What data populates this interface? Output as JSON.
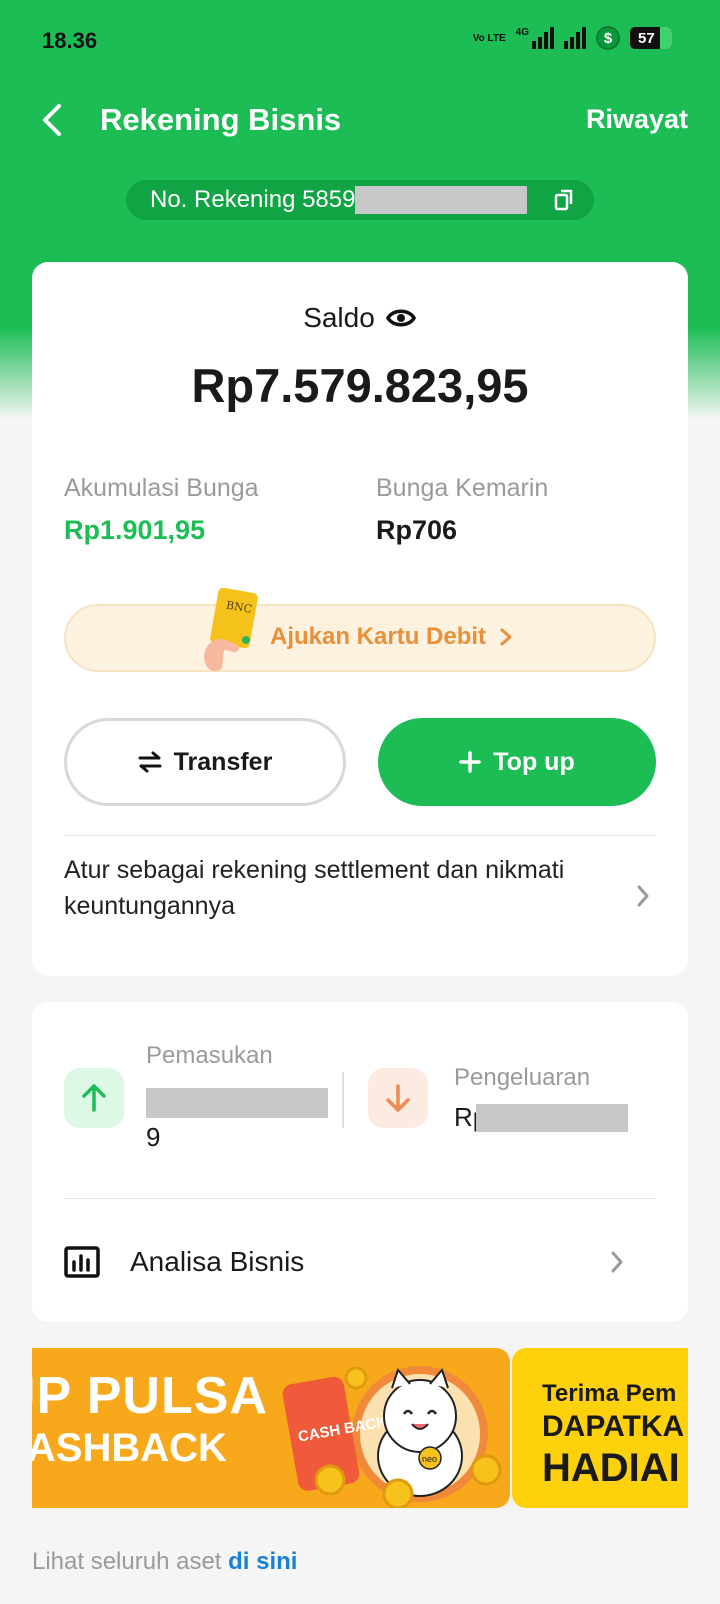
{
  "status_bar": {
    "time": "18.36",
    "network_type": "4G",
    "lte_label": "Vo LTE",
    "battery": "57"
  },
  "header": {
    "title": "Rekening Bisnis",
    "history_label": "Riwayat",
    "account_prefix": "No. Rekening 5859"
  },
  "balance_card": {
    "saldo_label": "Saldo",
    "balance": "Rp7.579.823,95",
    "accumulated_interest_label": "Akumulasi Bunga",
    "accumulated_interest_value": "Rp1.901,95",
    "yesterday_interest_label": "Bunga Kemarin",
    "yesterday_interest_value": "Rp706",
    "debit_card_cta": "Ajukan Kartu Debit",
    "debit_card_chip_text": "BNC",
    "transfer_label": "Transfer",
    "topup_label": "Top up",
    "settlement_text": "Atur sebagai rekening settlement dan nikmati keuntungannya"
  },
  "cashflow_card": {
    "income_label": "Pemasukan",
    "income_value_tail": "9",
    "expense_label": "Pengeluaran",
    "expense_value_prefix": "Rp",
    "analysis_label": "Analisa Bisnis"
  },
  "promos": [
    {
      "line1": "UP PULSA",
      "line2": "CASHBACK",
      "phone_text": "CASH BACK",
      "mascot_tag": "neo"
    },
    {
      "line1": "Terima Pem",
      "line2": "DAPATKA",
      "line3": "HADIAI"
    }
  ],
  "footer": {
    "text": "Lihat seluruh aset ",
    "link": "di sini"
  },
  "colors": {
    "brand_green": "#1dbd55",
    "accent_orange": "#e8903a",
    "link_blue": "#1a7fd6"
  }
}
